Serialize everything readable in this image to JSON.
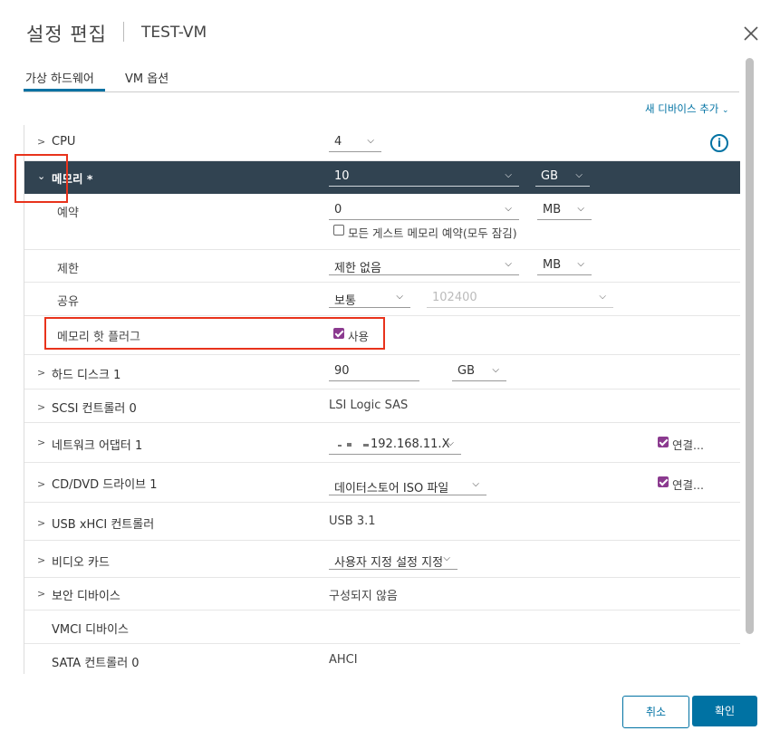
{
  "header": {
    "title": "설정 편집",
    "vm_name": "TEST-VM"
  },
  "tabs": [
    {
      "label": "가상 하드웨어"
    },
    {
      "label": "VM 옵션"
    }
  ],
  "add_device": "새 디바이스 추가",
  "hardware": {
    "cpu": {
      "label": "CPU",
      "value": "4"
    },
    "memory": {
      "label": "메모리 *",
      "value": "10",
      "unit": "GB",
      "reservation": {
        "label": "예약",
        "value": "0",
        "unit": "MB",
        "checkbox_label": "모든 게스트 메모리 예약(모두 잠김)"
      },
      "limit": {
        "label": "제한",
        "value": "제한 없음",
        "unit": "MB"
      },
      "shares": {
        "label": "공유",
        "value": "보통",
        "number": "102400"
      },
      "hotplug": {
        "label": "메모리 핫 플러그",
        "checkbox_label": "사용"
      }
    },
    "hard_disk": {
      "label": "하드 디스크 1",
      "value": "90",
      "unit": "GB"
    },
    "scsi": {
      "label": "SCSI 컨트롤러 0",
      "value": "LSI Logic SAS"
    },
    "network": {
      "label": "네트워크 어댑터 1",
      "value": "192.168.11.X",
      "connect_label": "연결..."
    },
    "cdrom": {
      "label": "CD/DVD 드라이브 1",
      "value": "데이터스토어 ISO 파일",
      "connect_label": "연결..."
    },
    "usb": {
      "label": "USB xHCI 컨트롤러",
      "value": "USB 3.1"
    },
    "video": {
      "label": "비디오 카드",
      "value": "사용자 지정 설정 지정"
    },
    "security": {
      "label": "보안 디바이스",
      "value": "구성되지 않음"
    },
    "vmci": {
      "label": "VMCI 디바이스"
    },
    "sata": {
      "label": "SATA 컨트롤러 0",
      "value": "AHCI"
    }
  },
  "footer": {
    "cancel": "취소",
    "ok": "확인"
  },
  "colors": {
    "accent": "#0072a3",
    "selected_row": "#314351",
    "checkbox": "#8b3a8f",
    "highlight_box": "#e8331c"
  }
}
